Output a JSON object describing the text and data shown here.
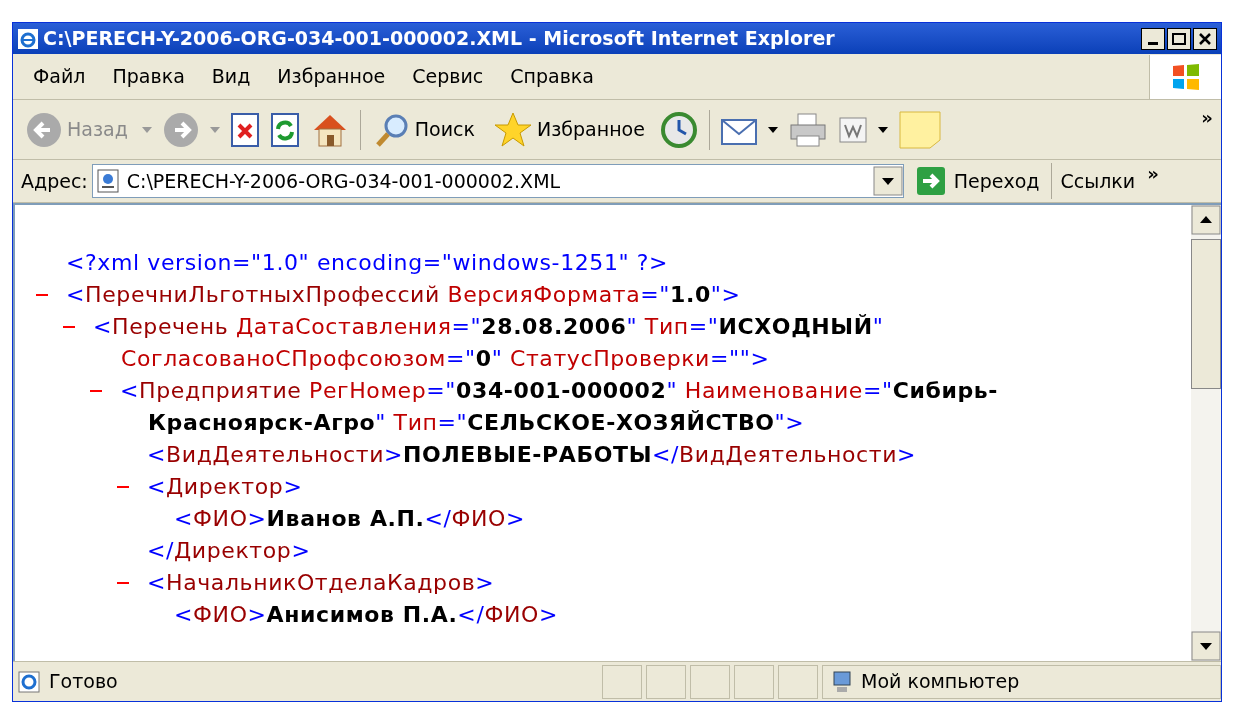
{
  "window": {
    "title": "C:\\PERECH-Y-2006-ORG-034-001-000002.XML - Microsoft Internet Explorer"
  },
  "menu": [
    "Файл",
    "Правка",
    "Вид",
    "Избранное",
    "Сервис",
    "Справка"
  ],
  "toolbar": {
    "back": {
      "label": "Назад",
      "disabled": true
    },
    "search": {
      "label": "Поиск"
    },
    "favorites": {
      "label": "Избранное"
    },
    "chevron": "»"
  },
  "address_bar": {
    "label": "Адрес:",
    "value": "C:\\PERECH-Y-2006-ORG-034-001-000002.XML",
    "go": "Переход",
    "links": "Ссылки",
    "chevron": "»"
  },
  "document": [
    {
      "kind": "leaf",
      "lines": [
        [
          {
            "kind": "markup",
            "text": "<?xml version=\"1.0\" encoding=\"windows-1251\" ?>"
          }
        ]
      ]
    },
    {
      "kind": "element",
      "expanded": true,
      "lines": [
        [
          {
            "kind": "markup",
            "text": "<"
          },
          {
            "kind": "tag",
            "text": "ПеречниЛьготныхПрофессий"
          },
          {
            "kind": "attribute",
            "text": " ВерсияФормата"
          },
          {
            "kind": "markup",
            "text": "=\""
          },
          {
            "kind": "value",
            "text": "1.0"
          },
          {
            "kind": "markup",
            "text": "\">"
          }
        ]
      ],
      "children": [
        {
          "kind": "element",
          "expanded": true,
          "lines": [
            [
              {
                "kind": "markup",
                "text": "<"
              },
              {
                "kind": "tag",
                "text": "Перечень"
              },
              {
                "kind": "attribute",
                "text": " ДатаСоставления"
              },
              {
                "kind": "markup",
                "text": "=\""
              },
              {
                "kind": "value",
                "text": "28.08.2006"
              },
              {
                "kind": "markup",
                "text": "\""
              },
              {
                "kind": "attribute",
                "text": " Тип"
              },
              {
                "kind": "markup",
                "text": "=\""
              },
              {
                "kind": "value",
                "text": "ИСХОДНЫЙ"
              },
              {
                "kind": "markup",
                "text": "\""
              }
            ],
            [
              {
                "kind": "attribute",
                "text": "СогласованоСПрофсоюзом"
              },
              {
                "kind": "markup",
                "text": "=\""
              },
              {
                "kind": "value",
                "text": "0"
              },
              {
                "kind": "markup",
                "text": "\""
              },
              {
                "kind": "attribute",
                "text": " СтатусПроверки"
              },
              {
                "kind": "markup",
                "text": "=\"\">"
              }
            ]
          ],
          "children": [
            {
              "kind": "element",
              "expanded": true,
              "lines": [
                [
                  {
                    "kind": "markup",
                    "text": "<"
                  },
                  {
                    "kind": "tag",
                    "text": "Предприятие"
                  },
                  {
                    "kind": "attribute",
                    "text": " РегНомер"
                  },
                  {
                    "kind": "markup",
                    "text": "=\""
                  },
                  {
                    "kind": "value",
                    "text": "034-001-000002"
                  },
                  {
                    "kind": "markup",
                    "text": "\""
                  },
                  {
                    "kind": "attribute",
                    "text": " Наименование"
                  },
                  {
                    "kind": "markup",
                    "text": "=\""
                  },
                  {
                    "kind": "value",
                    "text": "Сибирь-"
                  }
                ],
                [
                  {
                    "kind": "value",
                    "text": "Красноярск-Агро"
                  },
                  {
                    "kind": "markup",
                    "text": "\""
                  },
                  {
                    "kind": "attribute",
                    "text": " Тип"
                  },
                  {
                    "kind": "markup",
                    "text": "=\""
                  },
                  {
                    "kind": "value",
                    "text": "СЕЛЬСКОЕ-ХОЗЯЙСТВО"
                  },
                  {
                    "kind": "markup",
                    "text": "\">"
                  }
                ]
              ],
              "children": [
                {
                  "kind": "leaf",
                  "lines": [
                    [
                      {
                        "kind": "markup",
                        "text": "<"
                      },
                      {
                        "kind": "tag",
                        "text": "ВидДеятельности"
                      },
                      {
                        "kind": "markup",
                        "text": ">"
                      },
                      {
                        "kind": "value",
                        "text": "ПОЛЕВЫЕ-РАБОТЫ"
                      },
                      {
                        "kind": "markup",
                        "text": "</"
                      },
                      {
                        "kind": "tag",
                        "text": "ВидДеятельности"
                      },
                      {
                        "kind": "markup",
                        "text": ">"
                      }
                    ]
                  ]
                },
                {
                  "kind": "element",
                  "expanded": true,
                  "lines": [
                    [
                      {
                        "kind": "markup",
                        "text": "<"
                      },
                      {
                        "kind": "tag",
                        "text": "Директор"
                      },
                      {
                        "kind": "markup",
                        "text": ">"
                      }
                    ]
                  ],
                  "children": [
                    {
                      "kind": "leaf",
                      "lines": [
                        [
                          {
                            "kind": "markup",
                            "text": "<"
                          },
                          {
                            "kind": "tag",
                            "text": "ФИО"
                          },
                          {
                            "kind": "markup",
                            "text": ">"
                          },
                          {
                            "kind": "value",
                            "text": "Иванов А.П."
                          },
                          {
                            "kind": "markup",
                            "text": "</"
                          },
                          {
                            "kind": "tag",
                            "text": "ФИО"
                          },
                          {
                            "kind": "markup",
                            "text": ">"
                          }
                        ]
                      ]
                    }
                  ],
                  "close": [
                    {
                      "kind": "markup",
                      "text": "</"
                    },
                    {
                      "kind": "tag",
                      "text": "Директор"
                    },
                    {
                      "kind": "markup",
                      "text": ">"
                    }
                  ]
                },
                {
                  "kind": "element",
                  "expanded": true,
                  "lines": [
                    [
                      {
                        "kind": "markup",
                        "text": "<"
                      },
                      {
                        "kind": "tag",
                        "text": "НачальникОтделаКадров"
                      },
                      {
                        "kind": "markup",
                        "text": ">"
                      }
                    ]
                  ],
                  "children": [
                    {
                      "kind": "leaf",
                      "lines": [
                        [
                          {
                            "kind": "markup",
                            "text": "<"
                          },
                          {
                            "kind": "tag",
                            "text": "ФИО"
                          },
                          {
                            "kind": "markup",
                            "text": ">"
                          },
                          {
                            "kind": "value",
                            "text": "Анисимов П.А."
                          },
                          {
                            "kind": "markup",
                            "text": "</"
                          },
                          {
                            "kind": "tag",
                            "text": "ФИО"
                          },
                          {
                            "kind": "markup",
                            "text": ">"
                          }
                        ]
                      ]
                    }
                  ]
                }
              ]
            }
          ]
        }
      ]
    }
  ],
  "status_bar": {
    "text": "Готово",
    "zone": "Мой компьютер"
  }
}
